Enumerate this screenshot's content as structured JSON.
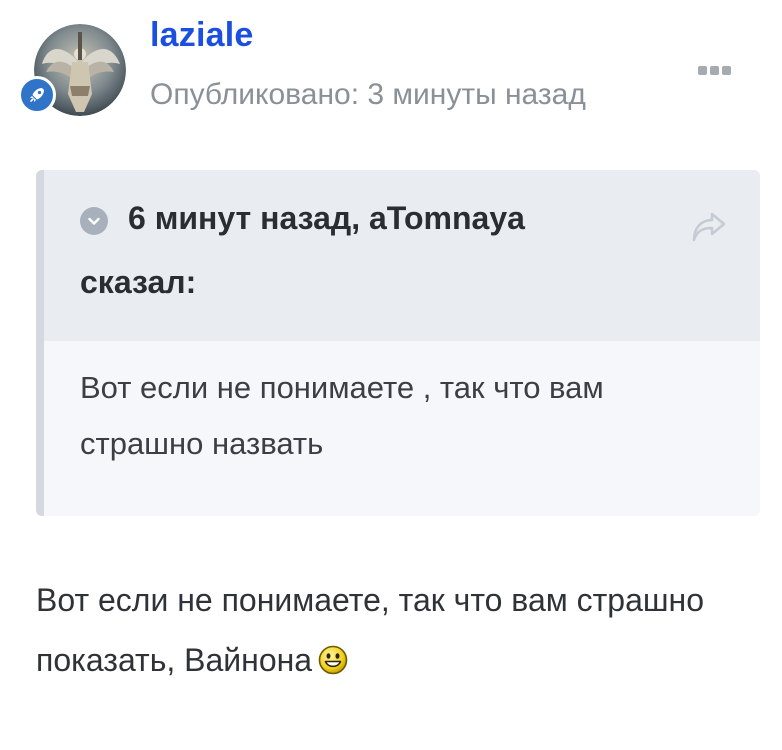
{
  "post": {
    "author": "laziale",
    "published": "Опубликовано: 3 минуты назад",
    "avatar_icon": "angel-statue-avatar",
    "badge_icon": "rocket-icon",
    "menu_icon": "more-dots-icon"
  },
  "quote": {
    "cite": "6 минут назад, aTomnaya сказал:",
    "body": "Вот если не понимаете , так что вам страшно назвать",
    "toggle_icon": "chevron-down-icon",
    "share_icon": "share-arrow-icon"
  },
  "content": {
    "text": "Вот если не понимаете, так что вам страшно показать, Вайнона",
    "emoji": "smiley-icon"
  },
  "colors": {
    "author": "#1b4fe0",
    "badge": "#2f74c7",
    "quote_header_bg": "#e9edf2",
    "quote_body_bg": "#f5f7fa",
    "muted": "#8a9098"
  }
}
